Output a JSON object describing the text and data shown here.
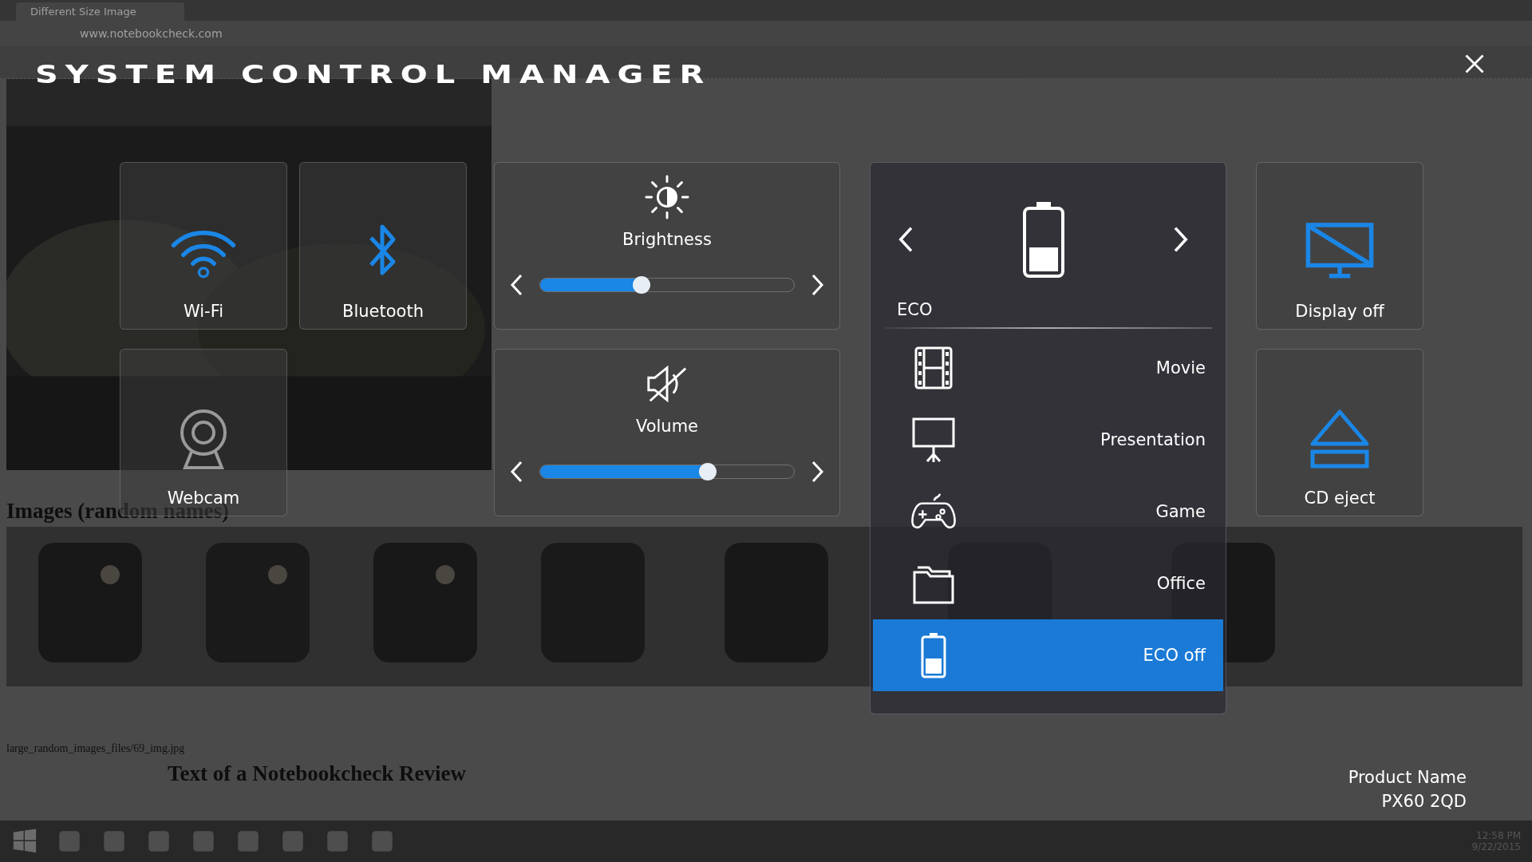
{
  "browser": {
    "tab_title": "Different Size Image",
    "url": "www.notebookcheck.com"
  },
  "page": {
    "heading": "Images (random names)",
    "caption": "large_random_images_files/69_img.jpg",
    "subheading": "Text of a Notebookcheck Review"
  },
  "taskbar": {
    "time": "12:58 PM",
    "date": "9/22/2015"
  },
  "manager": {
    "title": "SYSTEM CONTROL MANAGER",
    "left_tiles": [
      {
        "kind": "wifi",
        "label": "Wi-Fi",
        "on": true
      },
      {
        "kind": "bluetooth",
        "label": "Bluetooth",
        "on": true
      },
      {
        "kind": "webcam",
        "label": "Webcam",
        "on": false
      }
    ],
    "sliders": [
      {
        "kind": "brightness",
        "label": "Brightness",
        "level": 0.4
      },
      {
        "kind": "volume",
        "label": "Volume",
        "level": 0.66
      }
    ],
    "power": {
      "current": "ECO",
      "modes": [
        {
          "kind": "movie",
          "label": "Movie",
          "selected": false
        },
        {
          "kind": "presentation",
          "label": "Presentation",
          "selected": false
        },
        {
          "kind": "game",
          "label": "Game",
          "selected": false
        },
        {
          "kind": "office",
          "label": "Office",
          "selected": false
        },
        {
          "kind": "eco",
          "label": "ECO off",
          "selected": true
        }
      ]
    },
    "right_tiles": [
      {
        "kind": "display",
        "label": "Display off",
        "on": true
      },
      {
        "kind": "eject",
        "label": "CD eject",
        "on": true
      }
    ],
    "product": {
      "label": "Product Name",
      "model": "PX60 2QD"
    }
  }
}
